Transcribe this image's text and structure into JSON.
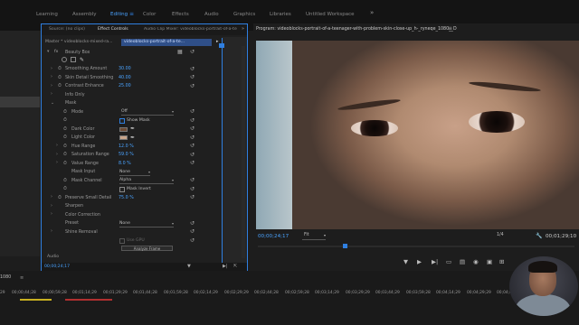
{
  "workspace": {
    "tabs": [
      {
        "label": "Learning"
      },
      {
        "label": "Assembly"
      },
      {
        "label": "Editing",
        "active": true
      },
      {
        "label": "Color"
      },
      {
        "label": "Effects"
      },
      {
        "label": "Audio"
      },
      {
        "label": "Graphics"
      },
      {
        "label": "Libraries"
      },
      {
        "label": "Untitled Workspace"
      }
    ],
    "more": "»"
  },
  "effect_controls": {
    "tabs": [
      "Source: (no clips)",
      "Effect Controls",
      "Audio Clip Mixer: videoblocks-portrait-of-a-te"
    ],
    "active_tab": "Effect Controls",
    "more": "»",
    "master_clip": "Master * videoblocks-mixed-ra...",
    "sequence_clip": "videoblocks-portrait-of-a-te...",
    "effect_name": "Beauty Box",
    "rows": {
      "smoothing_amount": {
        "label": "Smoothing Amount",
        "value": "30.00"
      },
      "skin_detail_smoothing": {
        "label": "Skin Detail Smoothing",
        "value": "40.00"
      },
      "contrast_enhance": {
        "label": "Contrast Enhance",
        "value": "25.00"
      },
      "info_only": {
        "label": "Info Only"
      },
      "mask": {
        "label": "Mask"
      },
      "mode": {
        "label": "Mode",
        "value": "Off"
      },
      "show_mask": {
        "label": "Show Mask"
      },
      "dark_color": {
        "label": "Dark Color",
        "color": "#6b4a34"
      },
      "light_color": {
        "label": "Light Color",
        "color": "#c9a58a"
      },
      "hue_range": {
        "label": "Hue Range",
        "value": "12.0 %"
      },
      "saturation_range": {
        "label": "Saturation Range",
        "value": "59.0 %"
      },
      "value_range": {
        "label": "Value Range",
        "value": "8.0 %"
      },
      "mask_input": {
        "label": "Mask Input",
        "value": "None"
      },
      "mask_channel": {
        "label": "Mask Channel",
        "value": "Alpha"
      },
      "mask_invert": {
        "label": "Mask Invert"
      },
      "preserve_small_detail": {
        "label": "Preserve Small Detail",
        "value": "75.0 %"
      },
      "sharpen": {
        "label": "Sharpen"
      },
      "color_correction": {
        "label": "Color Correction"
      },
      "preset": {
        "label": "Preset",
        "value": "None"
      },
      "shine_removal": {
        "label": "Shine Removal"
      },
      "use_gpu": {
        "label": "Use GPU"
      },
      "analyze_frame": {
        "label": "Analyze Frame"
      }
    },
    "audio_label": "Audio",
    "timecode": "00;00;24;17"
  },
  "program_monitor": {
    "title": "Program: videoblocks-portrait-of-a-teenager-with-problem-skin-close-up_h-_ryneqe_1080__D",
    "timecode": "00;00;24;17",
    "fit": "Fit",
    "ratio": "1/4",
    "duration": "00;01;29;10"
  },
  "timeline": {
    "sequence_name": "1080",
    "current_tc": "29",
    "ticks": [
      "29",
      "00;00;44;28",
      "00;00;59;28",
      "00;01;14;29",
      "00;01;29;29",
      "00;01;44;28",
      "00;01;59;28",
      "00;02;14;29",
      "00;02;29;29",
      "00;02;44;28",
      "00;02;59;28",
      "00;03;14;29",
      "00;03;29;29",
      "00;03;44;29",
      "00;03;59;28",
      "00;04;14;29",
      "00;04;29;29",
      "00;04;44;28"
    ]
  },
  "colors": {
    "accent": "#2f7fe0",
    "timecode": "#4aa3ff"
  }
}
